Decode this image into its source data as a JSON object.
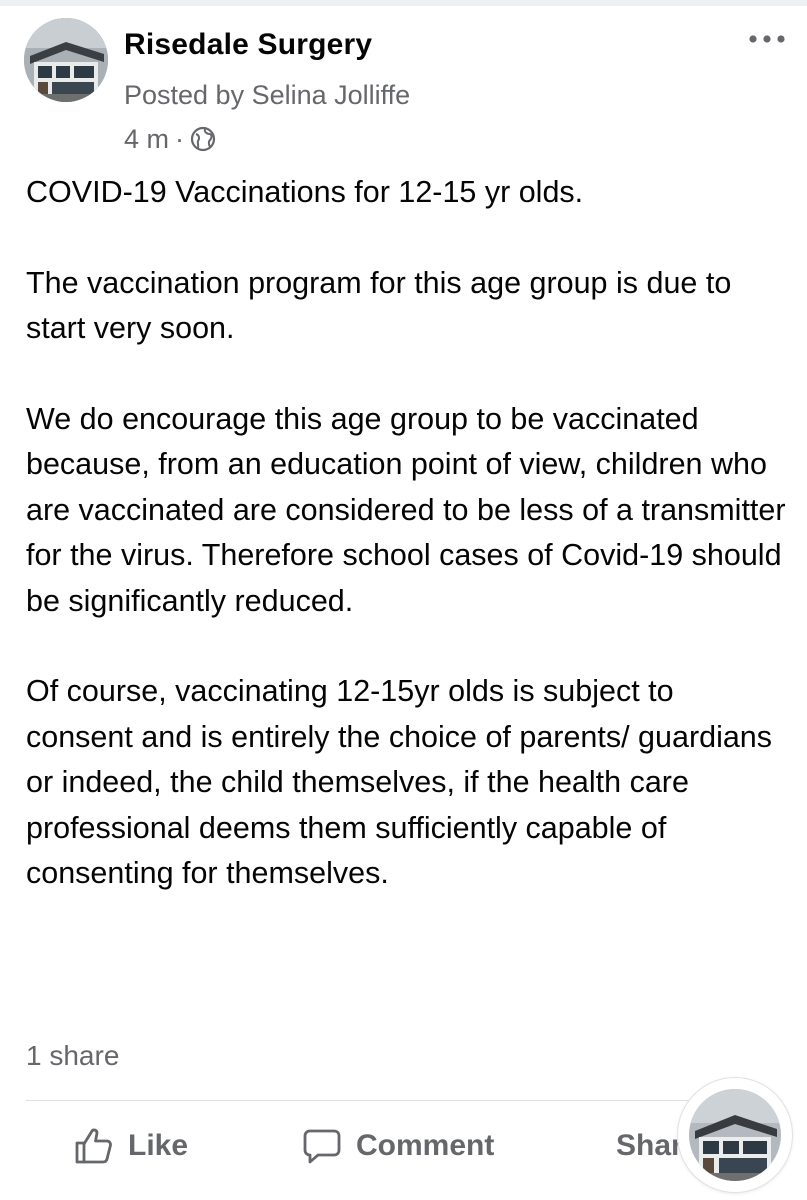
{
  "post": {
    "author": "Risedale Surgery",
    "posted_by": "Posted by Selina Jolliffe",
    "time": "4 m",
    "separator": "·",
    "audience_icon": "globe-icon",
    "menu_icon": "more-horizontal-icon",
    "body": [
      "COVID-19 Vaccinations for 12-15 yr olds.",
      "The vaccination program for this age group is due to start very soon.",
      "We do encourage this age group to be vaccinated because, from an education point of view, children who are vaccinated are considered to be less of a transmitter for the virus. Therefore school cases of Covid-19 should be significantly reduced.",
      "Of course, vaccinating 12-15yr olds is subject to consent and is entirely the choice of parents/ guardians or indeed, the child themselves, if the health care professional deems them sufficiently capable of consenting for themselves."
    ],
    "share_count": "1 share"
  },
  "actions": {
    "like_label": "Like",
    "comment_label": "Comment",
    "share_label": "Share"
  },
  "colors": {
    "text_primary": "#050505",
    "text_secondary": "#65676b",
    "divider": "#dddfe2"
  }
}
